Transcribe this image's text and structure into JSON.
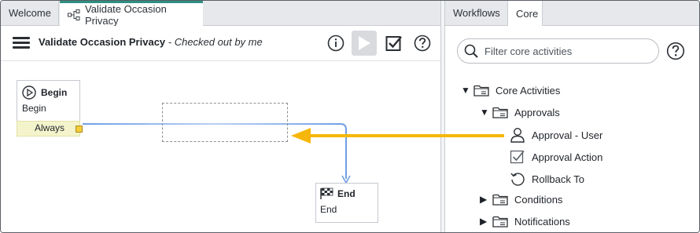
{
  "left_tabs": {
    "welcome": "Welcome",
    "workflow": "Validate Occasion Privacy"
  },
  "toolbar": {
    "title": "Validate Occasion Privacy",
    "subtitle": " - Checked out by me"
  },
  "nodes": {
    "begin": {
      "title": "Begin",
      "body": "Begin",
      "condition": "Always"
    },
    "end": {
      "title": "End",
      "body": "End"
    }
  },
  "right_tabs": {
    "workflows": "Workflows",
    "core": "Core"
  },
  "filter": {
    "placeholder": "Filter core activities"
  },
  "tree": {
    "core_activities": "Core Activities",
    "approvals": "Approvals",
    "approval_user": "Approval - User",
    "approval_action": "Approval Action",
    "rollback_to": "Rollback To",
    "conditions": "Conditions",
    "notifications": "Notifications"
  },
  "colors": {
    "active_tab_accent": "#2f8f83",
    "connector": "#6f9fe6",
    "drag_arrow": "#f6b70a",
    "exit_dot": "#f5cd3c"
  }
}
